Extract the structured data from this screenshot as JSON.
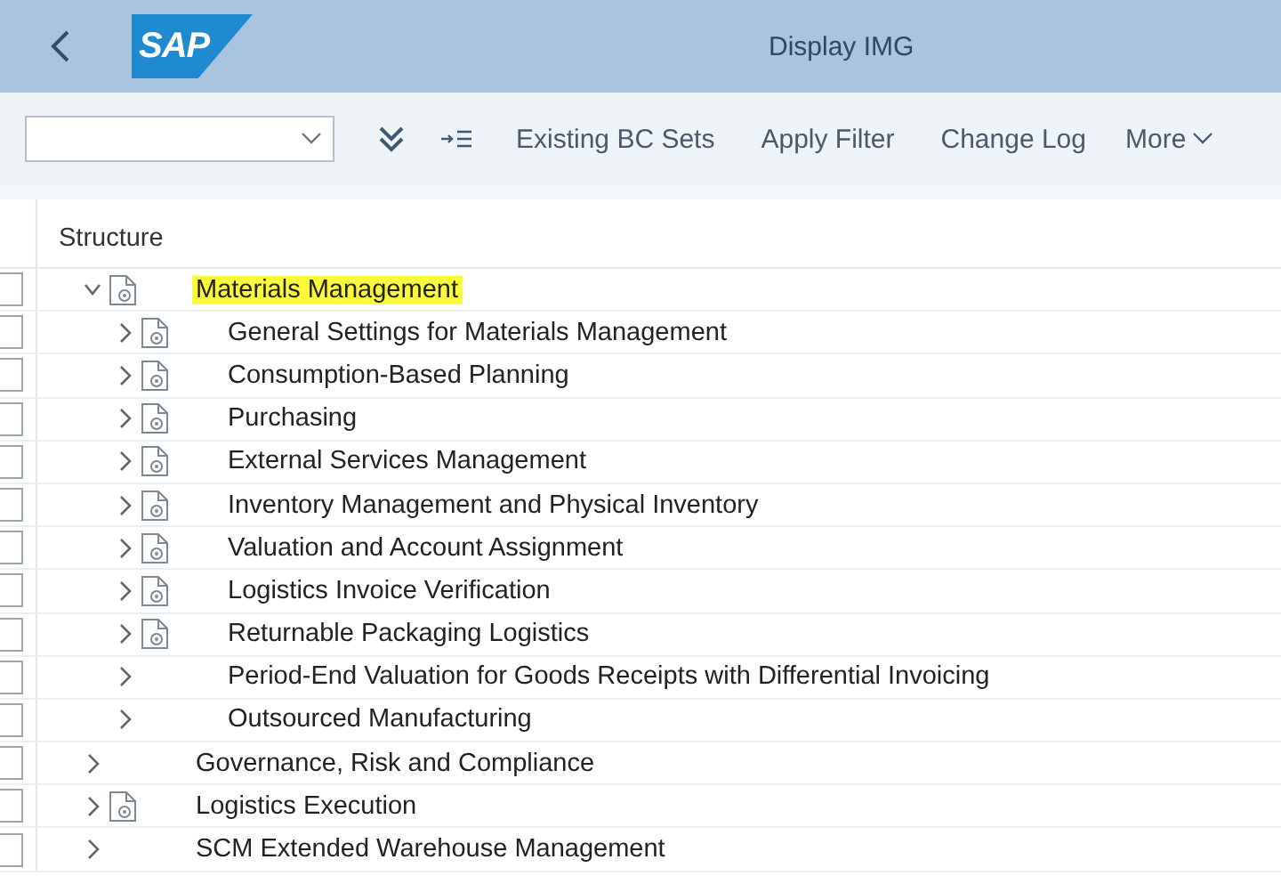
{
  "header": {
    "logo": "SAP",
    "title": "Display IMG"
  },
  "toolbar": {
    "buttons": [
      "Existing BC Sets",
      "Apply Filter",
      "Change Log"
    ],
    "more": "More"
  },
  "tree": {
    "column": "Structure",
    "nodes": [
      {
        "label": "Materials Management",
        "checked": false,
        "expanded": true,
        "icon": true,
        "highlighted": true,
        "children": [
          {
            "label": "General Settings for Materials Management",
            "checked": false,
            "expanded": false,
            "icon": true,
            "highlighted": false
          },
          {
            "label": "Consumption-Based Planning",
            "checked": false,
            "expanded": false,
            "icon": true,
            "highlighted": false
          },
          {
            "label": "Purchasing",
            "checked": false,
            "expanded": false,
            "icon": true,
            "highlighted": false
          },
          {
            "label": "External Services Management",
            "checked": false,
            "expanded": false,
            "icon": true,
            "highlighted": false
          },
          {
            "label": "Inventory Management and Physical Inventory",
            "checked": false,
            "expanded": false,
            "icon": true,
            "highlighted": false
          },
          {
            "label": "Valuation and Account Assignment",
            "checked": false,
            "expanded": false,
            "icon": true,
            "highlighted": false
          },
          {
            "label": "Logistics Invoice Verification",
            "checked": false,
            "expanded": false,
            "icon": true,
            "highlighted": false
          },
          {
            "label": "Returnable Packaging Logistics",
            "checked": false,
            "expanded": false,
            "icon": true,
            "highlighted": false
          },
          {
            "label": "Period-End Valuation for Goods Receipts with Differential Invoicing",
            "checked": false,
            "expanded": false,
            "icon": false,
            "highlighted": false
          },
          {
            "label": "Outsourced Manufacturing",
            "checked": false,
            "expanded": false,
            "icon": false,
            "highlighted": false
          }
        ]
      },
      {
        "label": "Governance, Risk and Compliance",
        "checked": false,
        "expanded": false,
        "icon": false,
        "highlighted": false
      },
      {
        "label": "Logistics Execution",
        "checked": false,
        "expanded": false,
        "icon": true,
        "highlighted": false
      },
      {
        "label": "SCM Extended Warehouse Management",
        "checked": false,
        "expanded": false,
        "icon": false,
        "highlighted": false
      }
    ]
  }
}
